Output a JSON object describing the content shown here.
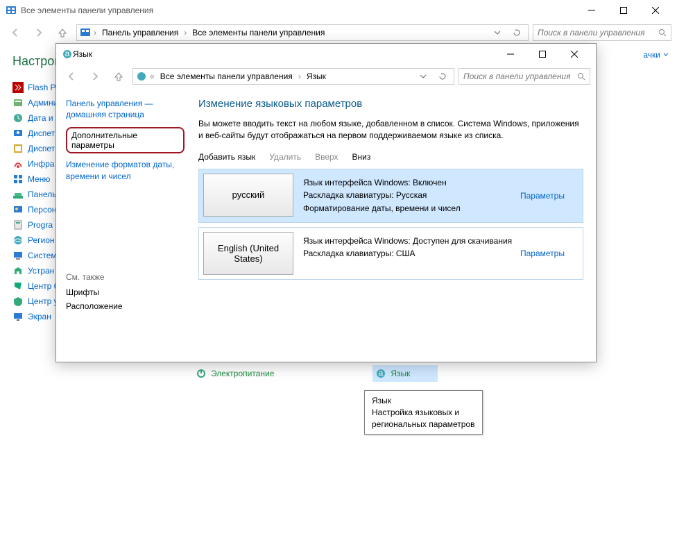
{
  "back_window": {
    "title": "Все элементы панели управления",
    "breadcrumb": [
      "Панель управления",
      "Все элементы панели управления"
    ],
    "search_placeholder": "Поиск в панели управления",
    "heading_partial": "Настрой",
    "right_link_partial": "ачки",
    "items": [
      "Flash Pl",
      "Админи",
      "Дата и",
      "Диспет",
      "Диспет",
      "Инфра",
      "Меню",
      "Панель",
      "Персон",
      "Progra",
      "Регион",
      "Систем",
      "Устран",
      "Центр б",
      "Центр у",
      "Экран"
    ],
    "right_items": {
      "power": "Электропитание",
      "lang": "Язык"
    },
    "tooltip": {
      "title": "Язык",
      "line1": "Настройка языковых и",
      "line2": "региональных параметров"
    }
  },
  "dialog": {
    "title": "Язык",
    "breadcrumb": [
      "Все элементы панели управления",
      "Язык"
    ],
    "search_placeholder": "Поиск в панели управления",
    "side": {
      "home": "Панель управления — домашняя страница",
      "advanced": "Дополнительные параметры",
      "formats": "Изменение форматов даты, времени и чисел",
      "see_also": "См. также",
      "fonts": "Шрифты",
      "location": "Расположение"
    },
    "main": {
      "heading": "Изменение языковых параметров",
      "description": "Вы можете вводить текст на любом языке, добавленном в список. Система Windows, приложения и веб-сайты будут отображаться на первом поддерживаемом языке из списка.",
      "actions": {
        "add": "Добавить язык",
        "remove": "Удалить",
        "up": "Вверх",
        "down": "Вниз"
      },
      "params_label": "Параметры",
      "languages": [
        {
          "name": "русский",
          "lines": [
            "Язык интерфейса Windows: Включен",
            "Раскладка клавиатуры: Русская",
            "Форматирование даты, времени и чисел"
          ],
          "selected": true
        },
        {
          "name": "English (United States)",
          "lines": [
            "Язык интерфейса Windows: Доступен для скачивания",
            "Раскладка клавиатуры: США"
          ],
          "selected": false
        }
      ]
    }
  }
}
